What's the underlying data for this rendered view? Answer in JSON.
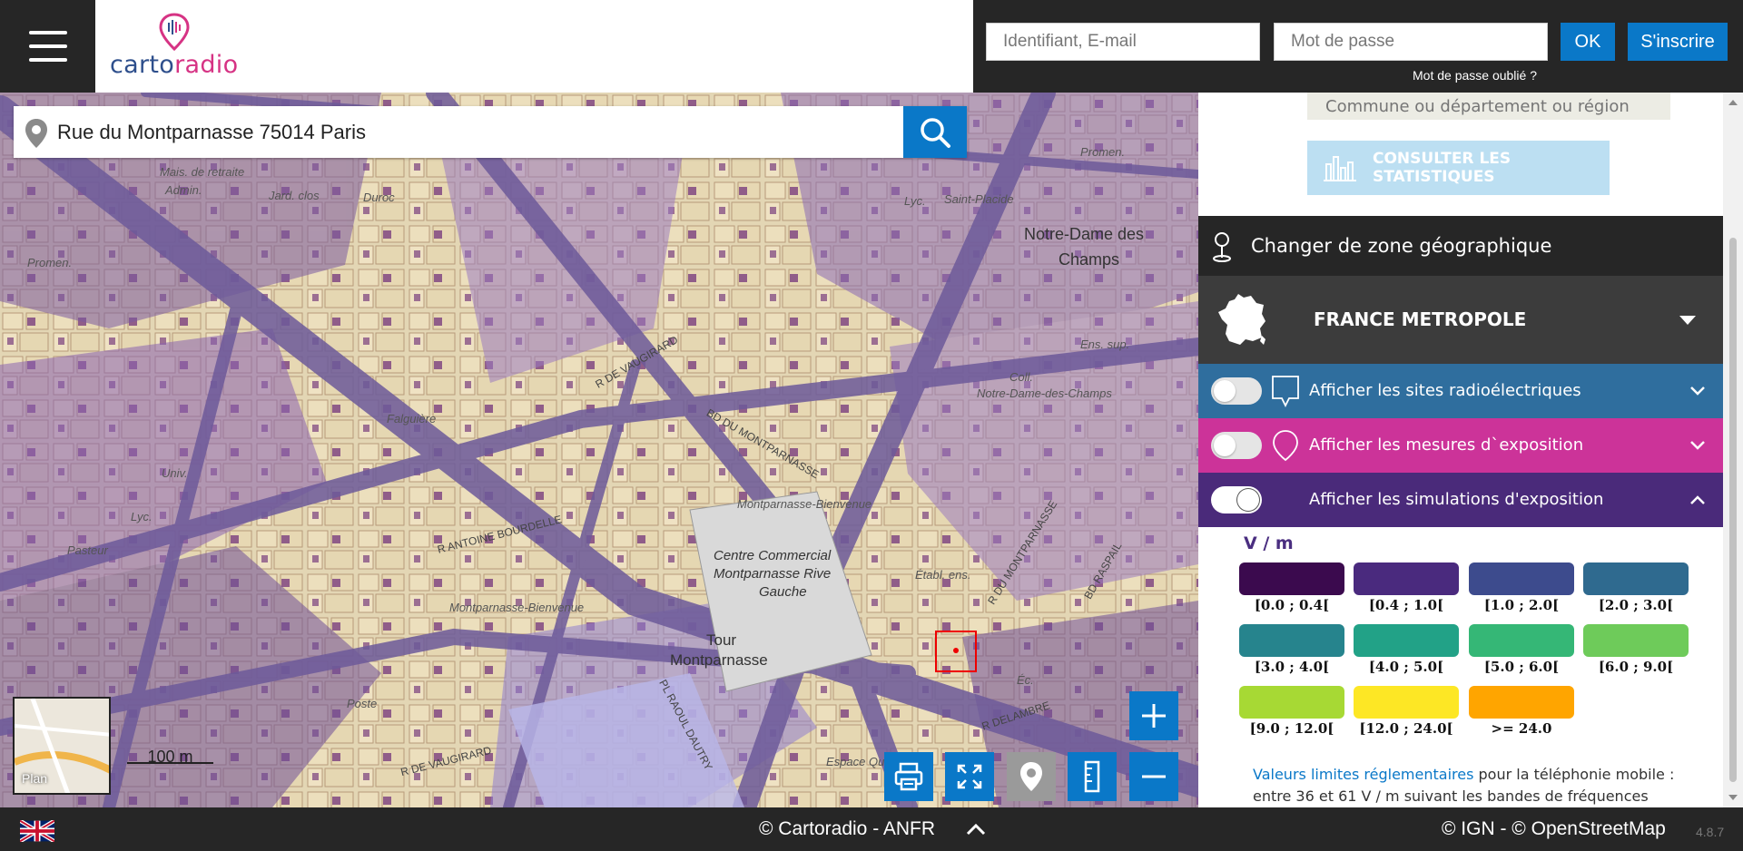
{
  "header": {
    "logo_part1": "carto",
    "logo_part2": "radio",
    "login_placeholder": "Identifiant, E-mail",
    "password_placeholder": "Mot de passe",
    "ok_label": "OK",
    "signup_label": "S'inscrire",
    "forgot_label": "Mot de passe oublié ?"
  },
  "search": {
    "value": "Rue du Montparnasse 75014 Paris"
  },
  "map": {
    "labels": [
      {
        "name": "map-label-notre-dame-1",
        "text": "Notre-Dame des"
      },
      {
        "name": "map-label-notre-dame-2",
        "text": "Champs"
      },
      {
        "name": "map-label-centre-1",
        "text": "Centre Commercial"
      },
      {
        "name": "map-label-centre-2",
        "text": "Montparnasse Rive"
      },
      {
        "name": "map-label-centre-3",
        "text": "Gauche"
      },
      {
        "name": "map-label-tour-1",
        "text": "Tour"
      },
      {
        "name": "map-label-tour-2",
        "text": "Montparnasse"
      },
      {
        "name": "map-label-bd-montparnasse",
        "text": "BD DU MONTPARNASSE"
      },
      {
        "name": "map-label-rue-vaugirard",
        "text": "R DE VAUGIRARD"
      },
      {
        "name": "map-label-mp-bienvenue",
        "text": "Montparnasse-Bienvenue"
      },
      {
        "name": "map-label-mp-bienvenue-2",
        "text": "Montparnasse-Bienvenue"
      },
      {
        "name": "map-label-falguiere",
        "text": "Falguière"
      },
      {
        "name": "map-label-pasteur",
        "text": "Pasteur"
      },
      {
        "name": "map-label-duroc",
        "text": "Duroc"
      },
      {
        "name": "map-label-notre-dame-champs-metro",
        "text": "Notre-Dame-des-Champs"
      },
      {
        "name": "map-label-saint-placide",
        "text": "Saint-Placide"
      },
      {
        "name": "map-label-poste",
        "text": "Poste"
      },
      {
        "name": "map-label-univ",
        "text": "Univ."
      },
      {
        "name": "map-label-lyc",
        "text": "Lyc."
      },
      {
        "name": "map-label-college",
        "text": "Coll."
      },
      {
        "name": "map-label-rue-delambre",
        "text": "R DELAMBRE"
      },
      {
        "name": "map-label-bd-raspail",
        "text": "BD RASPAIL"
      },
      {
        "name": "map-label-maison-retraite",
        "text": "Mais. de retraite"
      },
      {
        "name": "map-label-admin",
        "text": "Admin."
      },
      {
        "name": "map-label-r-antoine-bourdelle",
        "text": "R ANTOINE BOURDELLE"
      },
      {
        "name": "map-label-pl-raoul-dautry",
        "text": "PL RAOUL DAUTRY"
      },
      {
        "name": "map-label-etabl-ens",
        "text": "Établ. ens."
      },
      {
        "name": "map-label-r-du-montparnasse",
        "text": "R DU MONTPARNASSE"
      },
      {
        "name": "map-label-ec",
        "text": "Éc."
      },
      {
        "name": "map-label-espace-quiq",
        "text": "Espace Quiq"
      },
      {
        "name": "map-label-jard-clos",
        "text": "Jard. clos"
      },
      {
        "name": "map-label-lyc-2",
        "text": "Lyc."
      },
      {
        "name": "map-label-ens-sup",
        "text": "Ens. sup."
      },
      {
        "name": "map-label-promen",
        "text": "Promen."
      },
      {
        "name": "map-label-promen-2",
        "text": "Promen."
      },
      {
        "name": "map-label-r-de-vaugirard-2",
        "text": "R DE VAUGIRARD"
      }
    ],
    "minimap_label": "Plan",
    "scale_label": "100 m"
  },
  "panel": {
    "commune_placeholder": "Commune ou département ou région",
    "stats_label": "CONSULTER LES STATISTIQUES",
    "zone_label": "Changer de zone géographique",
    "region_label": "FRANCE METROPOLE",
    "layers": [
      {
        "label": "Afficher les sites radioélectriques",
        "color": "#2f6e9e",
        "on": false
      },
      {
        "label": "Afficher les mesures d`exposition",
        "color": "#cc3399",
        "on": false
      },
      {
        "label": "Afficher les simulations d'exposition",
        "color": "#4a2a7a",
        "on": true
      }
    ],
    "legend_title": "V / m",
    "legend": [
      {
        "label": "[0.0 ; 0.4[",
        "color": "#3b0a4e"
      },
      {
        "label": "[0.4 ; 1.0[",
        "color": "#4a2a7e"
      },
      {
        "label": "[1.0 ; 2.0[",
        "color": "#3d4b8d"
      },
      {
        "label": "[2.0 ; 3.0[",
        "color": "#2f6a8f"
      },
      {
        "label": "[3.0 ; 4.0[",
        "color": "#26848d"
      },
      {
        "label": "[4.0 ; 5.0[",
        "color": "#22a287"
      },
      {
        "label": "[5.0 ; 6.0[",
        "color": "#35b776"
      },
      {
        "label": "[6.0 ; 9.0[",
        "color": "#6ecb5a"
      },
      {
        "label": "[9.0 ; 12.0[",
        "color": "#a7d934"
      },
      {
        "label": "[12.0 ; 24.0[",
        "color": "#fde725"
      },
      {
        "label": ">= 24.0",
        "color": "#ffa500"
      }
    ],
    "note_link": "Valeurs limites réglementaires",
    "note_text1": " pour la téléphonie mobile :",
    "note_text2": "entre 36 et 61 V / m suivant les bandes de fréquences"
  },
  "footer": {
    "center": "© Cartoradio - ANFR",
    "right": "© IGN - © OpenStreetMap",
    "version": "4.8.7"
  },
  "colors": {
    "accent": "#0a78c8",
    "dark": "#262626"
  }
}
